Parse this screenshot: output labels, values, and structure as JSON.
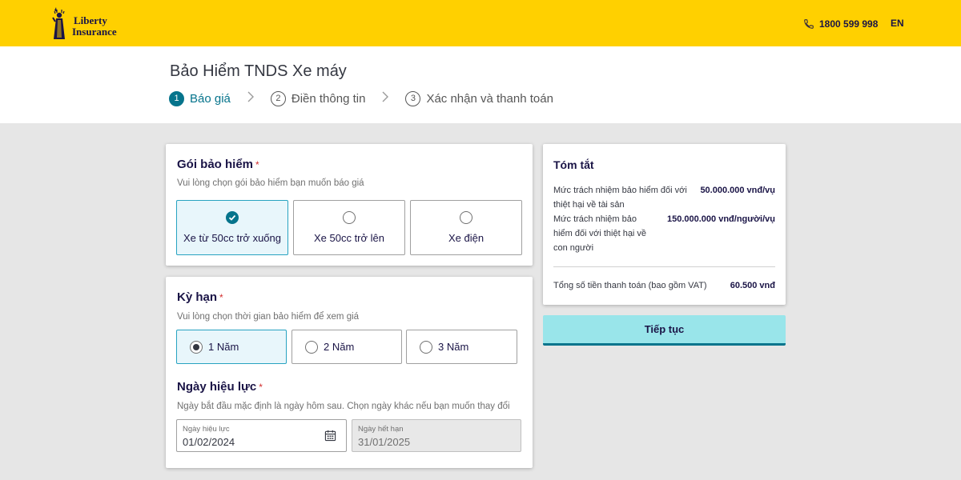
{
  "header": {
    "logo_line1": "Liberty",
    "logo_line2": "Insurance",
    "phone": "1800 599 998",
    "language": "EN",
    "brand_color": "#ffd000"
  },
  "page": {
    "title": "Bảo Hiểm TNDS Xe máy",
    "steps": [
      {
        "num": "1",
        "label": "Báo giá",
        "active": true
      },
      {
        "num": "2",
        "label": "Điền thông tin",
        "active": false
      },
      {
        "num": "3",
        "label": "Xác nhận và thanh toán",
        "active": false
      }
    ]
  },
  "package": {
    "title": "Gói bảo hiểm",
    "required_mark": "*",
    "subtitle": "Vui lòng chọn gói bảo hiểm bạn muốn báo giá",
    "options": [
      {
        "label": "Xe từ 50cc trở xuống",
        "selected": true
      },
      {
        "label": "Xe 50cc trở lên",
        "selected": false
      },
      {
        "label": "Xe điện",
        "selected": false
      }
    ]
  },
  "term": {
    "title": "Kỳ hạn",
    "required_mark": "*",
    "subtitle": "Vui lòng chọn thời gian bảo hiểm để xem giá",
    "options": [
      {
        "label": "1 Năm",
        "selected": true
      },
      {
        "label": "2 Năm",
        "selected": false
      },
      {
        "label": "3 Năm",
        "selected": false
      }
    ]
  },
  "effective": {
    "title": "Ngày hiệu lực",
    "required_mark": "*",
    "subtitle": "Ngày bắt đầu mặc định là ngày hôm sau. Chọn ngày khác nếu bạn muốn thay đổi",
    "start_label": "Ngày hiệu lực",
    "start_value": "01/02/2024",
    "end_label": "Ngày hết hạn",
    "end_value": "31/01/2025"
  },
  "summary": {
    "title": "Tóm tắt",
    "property_label_1": "Mức trách nhiệm bảo hiểm đối với",
    "property_label_2": "thiệt hại về tài sản",
    "property_value": "50.000.000 vnđ/vụ",
    "people_label_1": "Mức trách nhiệm bảo",
    "people_label_2": "hiểm đối với thiệt hại về",
    "people_label_3": "con người",
    "people_value": "150.000.000 vnđ/người/vụ",
    "total_label": "Tổng số tiền thanh toán (bao gồm VAT)",
    "total_value": "60.500 vnđ"
  },
  "actions": {
    "next_label": "Tiếp tục"
  }
}
